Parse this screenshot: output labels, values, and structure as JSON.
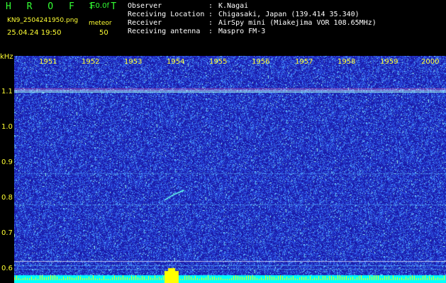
{
  "header": {
    "title": "H R O F F T",
    "version": "1.0.0f",
    "filename": "KN9_2504241950.png",
    "mode": "meteor",
    "datetime": "25.04.24 19:50",
    "count": "50"
  },
  "station": [
    {
      "label": "Observer",
      "value": "K.Nagai"
    },
    {
      "label": "Receiving Location",
      "value": "Chigasaki, Japan (139.414 35.340)"
    },
    {
      "label": "Receiver",
      "value": "AirSpy mini (Miakejima VOR 108.65MHz)"
    },
    {
      "label": "Receiving antenna",
      "value": "Maspro FM-3"
    }
  ],
  "axis": {
    "y_unit": "kHz",
    "y_ticks": [
      "1.1",
      "1.0",
      "0.9",
      "0.8",
      "0.7",
      "0.6"
    ],
    "x_ticks": [
      "1951",
      "1952",
      "1953",
      "1954",
      "1955",
      "1956",
      "1957",
      "1958",
      "1959",
      "2000"
    ]
  },
  "colors": {
    "background": "#1a1aa8",
    "noise": "#3a6cff",
    "signal": "#66ffee",
    "bottom_band": "#00ffff",
    "peak": "#ffff00",
    "label": "#ffff33",
    "title": "#33ff33"
  }
}
